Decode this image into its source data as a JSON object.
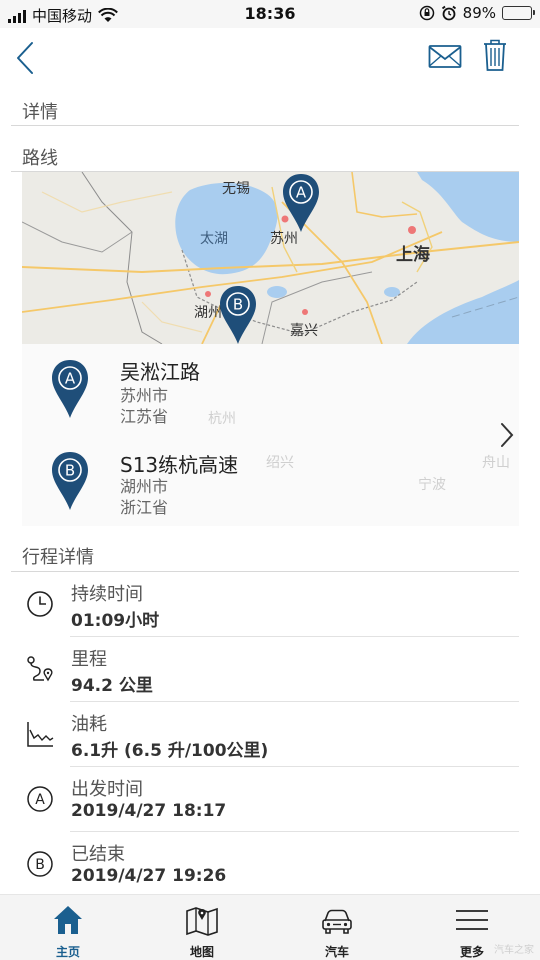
{
  "status_bar": {
    "carrier": "中国移动",
    "time": "18:36",
    "battery_percent": "89%",
    "battery_level": 0.89
  },
  "nav": {
    "back_icon": "chevron-left-icon",
    "mail_icon": "mail-icon",
    "trash_icon": "trash-icon"
  },
  "sections": {
    "details": "详情",
    "route": "路线",
    "trip_details": "行程详情"
  },
  "map": {
    "labels": {
      "wuxi": "无锡",
      "taihu": "太湖",
      "suzhou": "苏州",
      "shanghai": "上海",
      "huzhou": "湖州",
      "jiaxing": "嘉兴"
    },
    "markers": [
      "A",
      "B"
    ],
    "colors": {
      "water": "#a9cdef",
      "land": "#ecebe6",
      "road": "#f5c869",
      "marker": "#1f4e79"
    }
  },
  "route": {
    "start": {
      "marker": "A",
      "name": "吴淞江路",
      "city": "苏州市",
      "province": "江苏省"
    },
    "end": {
      "marker": "B",
      "name": "S13练杭高速",
      "city": "湖州市",
      "province": "浙江省"
    },
    "ghost_labels": {
      "hangzhou": "杭州",
      "shaoxing": "绍兴",
      "ningbo": "宁波",
      "zhoushan": "舟山"
    }
  },
  "trip": {
    "items": [
      {
        "icon": "clock-icon",
        "label": "持续时间",
        "value": "01:09小时"
      },
      {
        "icon": "route-icon",
        "label": "里程",
        "value": "94.2 公里"
      },
      {
        "icon": "fuel-chart-icon",
        "label": "油耗",
        "value": "6.1升 (6.5 升/100公里)"
      },
      {
        "icon": "start-a-icon",
        "label": "出发时间",
        "value": "2019/4/27 18:17"
      },
      {
        "icon": "end-b-icon",
        "label": "已结束",
        "value": "2019/4/27 19:26"
      }
    ]
  },
  "tabs": [
    {
      "icon": "home-icon",
      "label": "主页",
      "active": true
    },
    {
      "icon": "map-icon",
      "label": "地图",
      "active": false
    },
    {
      "icon": "car-icon",
      "label": "汽车",
      "active": false
    },
    {
      "icon": "menu-icon",
      "label": "更多",
      "active": false
    }
  ],
  "watermark": "汽车之家",
  "colors": {
    "accent": "#1a5f8f",
    "marker": "#1f4e79"
  }
}
